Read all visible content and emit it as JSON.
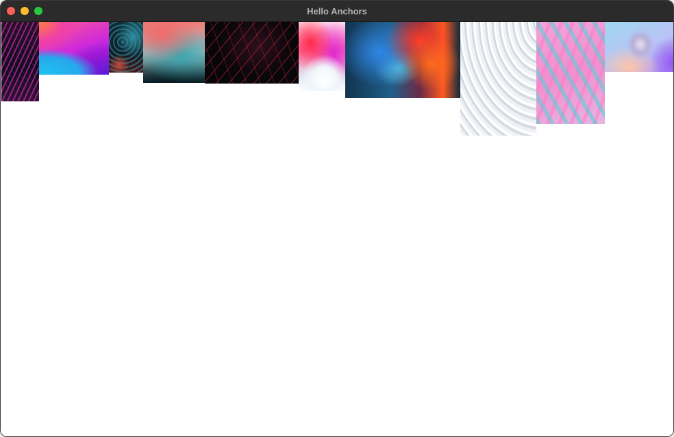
{
  "window": {
    "title": "Hello Anchors",
    "controls": {
      "close_color": "#fe5f57",
      "minimize_color": "#febc2e",
      "maximize_color": "#28c840"
    }
  },
  "images": [
    {
      "name": "image-purple-hair-strands"
    },
    {
      "name": "image-blue-purple-wave"
    },
    {
      "name": "image-teal-red-texture"
    },
    {
      "name": "image-coral-teal-ink"
    },
    {
      "name": "image-red-light-trails"
    },
    {
      "name": "image-pink-red-gradient"
    },
    {
      "name": "image-blue-orange-ink-smoke"
    },
    {
      "name": "image-white-wave-lines"
    },
    {
      "name": "image-pink-teal-marble"
    },
    {
      "name": "image-pastel-sphere"
    }
  ]
}
